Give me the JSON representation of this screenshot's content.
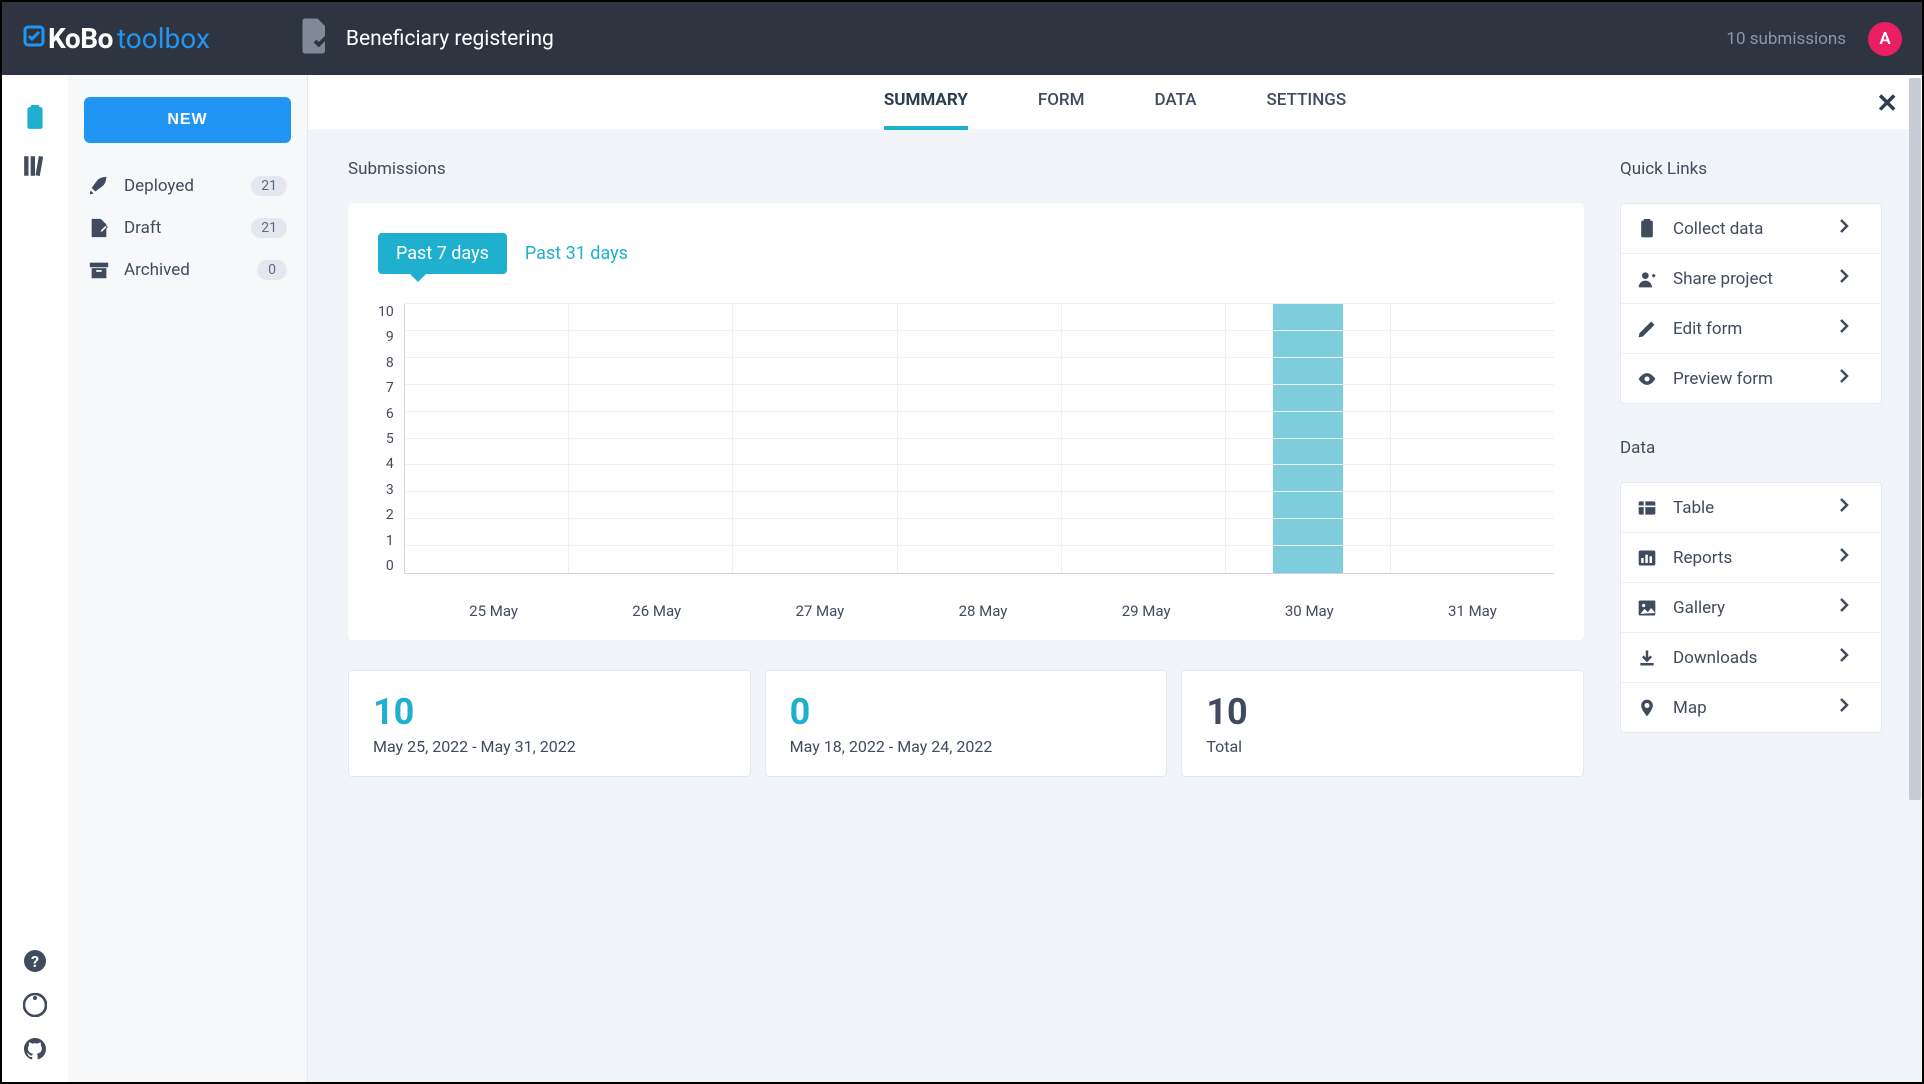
{
  "brand": {
    "kobo": "KoBo",
    "toolbox": "toolbox"
  },
  "project": {
    "title": "Beneficiary registering"
  },
  "header": {
    "submission_text": "10 submissions",
    "avatar_initial": "A"
  },
  "sidebar": {
    "new_label": "NEW",
    "items": [
      {
        "label": "Deployed",
        "count": "21"
      },
      {
        "label": "Draft",
        "count": "21"
      },
      {
        "label": "Archived",
        "count": "0"
      }
    ]
  },
  "tabs": {
    "summary": "SUMMARY",
    "form": "FORM",
    "data": "DATA",
    "settings": "SETTINGS"
  },
  "sections": {
    "submissions": "Submissions",
    "quick_links": "Quick Links",
    "data": "Data"
  },
  "range": {
    "past7": "Past 7 days",
    "past31": "Past 31 days"
  },
  "chart_data": {
    "type": "bar",
    "categories": [
      "25 May",
      "26 May",
      "27 May",
      "28 May",
      "29 May",
      "30 May",
      "31 May"
    ],
    "values": [
      0,
      0,
      0,
      0,
      0,
      10,
      0
    ],
    "y_ticks": [
      0,
      1,
      2,
      3,
      4,
      5,
      6,
      7,
      8,
      9,
      10
    ],
    "ylim": [
      0,
      10
    ],
    "title": "Submissions",
    "xlabel": "",
    "ylabel": ""
  },
  "stats": [
    {
      "value": "10",
      "sub": "May 25, 2022 - May 31, 2022",
      "kind": "range"
    },
    {
      "value": "0",
      "sub": "May 18, 2022 - May 24, 2022",
      "kind": "range"
    },
    {
      "value": "10",
      "sub": "Total",
      "kind": "total"
    }
  ],
  "quick_links": [
    {
      "label": "Collect data"
    },
    {
      "label": "Share project"
    },
    {
      "label": "Edit form"
    },
    {
      "label": "Preview form"
    }
  ],
  "data_links": [
    {
      "label": "Table"
    },
    {
      "label": "Reports"
    },
    {
      "label": "Gallery"
    },
    {
      "label": "Downloads"
    },
    {
      "label": "Map"
    }
  ]
}
